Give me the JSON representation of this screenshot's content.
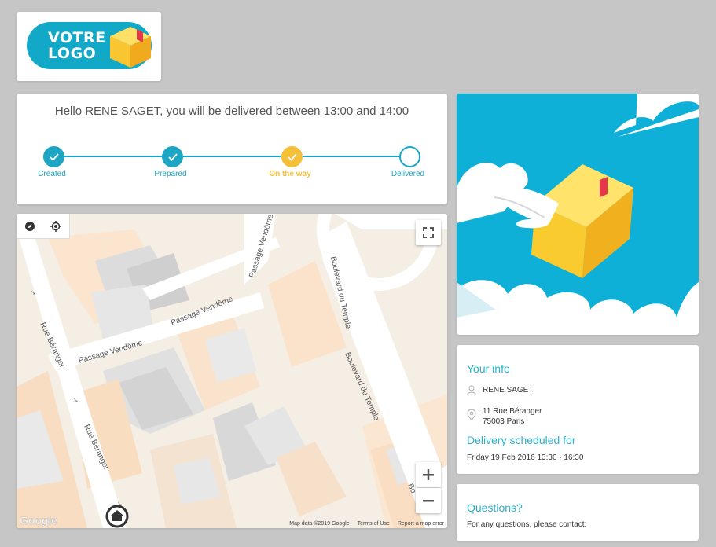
{
  "logo": {
    "line1": "VOTRE",
    "line2": "LOGO"
  },
  "tracking": {
    "greeting": "Hello RENE SAGET, you will be delivered between 13:00 and 14:00",
    "steps": [
      {
        "label": "Created",
        "status": "done"
      },
      {
        "label": "Prepared",
        "status": "done"
      },
      {
        "label": "On the way",
        "status": "current"
      },
      {
        "label": "Delivered",
        "status": "pending"
      }
    ]
  },
  "colors": {
    "accent": "#1ca6c4",
    "current": "#f4c03a",
    "sky": "#0fb0d8"
  },
  "map": {
    "streets": {
      "rue_beranger_1": "Rue Béranger",
      "rue_beranger_2": "Rue Béranger",
      "passage_vendome_1": "Passage Vendôme",
      "passage_vendome_2": "Passage Vendôme",
      "passage_vendome_3": "Passage Vendôme",
      "boulevard_temple_1": "Boulevard du Temple",
      "boulevard_temple_2": "Boulevard du Temple",
      "bo": "Bo"
    },
    "google": "Google",
    "footer": {
      "data": "Map data ©2019 Google",
      "terms": "Terms of Use",
      "report": "Report a map error"
    },
    "icons": [
      "compass-icon",
      "locate-icon",
      "fullscreen-icon",
      "zoom-in-icon",
      "zoom-out-icon",
      "home-marker-icon"
    ]
  },
  "info": {
    "title": "Your info",
    "name": "RENE SAGET",
    "address_line1": "11 Rue Béranger",
    "address_line2": "75003 Paris",
    "delivery_title": "Delivery scheduled for",
    "delivery_time": "Friday 19 Feb 2016 13:30 - 16:30"
  },
  "questions": {
    "title": "Questions?",
    "text": "For any questions, please contact:"
  }
}
